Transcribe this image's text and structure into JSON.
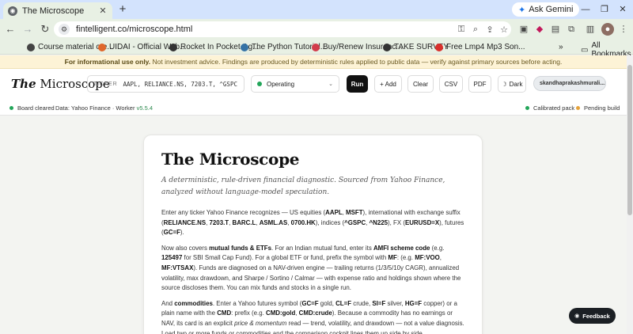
{
  "browser": {
    "tab": {
      "title": "The Microscope",
      "favicon": "globe-icon"
    },
    "gemini_label": "Ask Gemini",
    "url": "fintelligent.co/microscope.html",
    "bookmarks": [
      {
        "label": "Course material cre...",
        "color": "#444"
      },
      {
        "label": "UIDAI - Official Web...",
        "color": "#e0672c"
      },
      {
        "label": "Rocket In Pocket-Ag...",
        "color": "#333"
      },
      {
        "label": "The Python Tutorial...",
        "color": "#3572a5"
      },
      {
        "label": "Buy/Renew Insuranc...",
        "color": "#d23b4b"
      },
      {
        "label": "TAKE SURVEY",
        "color": "#333"
      },
      {
        "label": "Free Lmp4 Mp3 Son...",
        "color": "#d9302c"
      }
    ],
    "all_bookmarks": "All Bookmarks"
  },
  "disclaimer": {
    "bold": "For informational use only.",
    "text": "Not investment advice. Findings are produced by deterministic rules applied to public data — verify against primary sources before acting."
  },
  "appbar": {
    "logo_the": "The",
    "logo_rest": "Microscope",
    "ticker_label": "TICKER",
    "ticker_value": "AAPL, RELIANCE.NS, 7203.T, ^GSPC",
    "mode": "Operating",
    "run": "Run",
    "add": "+ Add",
    "clear": "Clear",
    "csv": "CSV",
    "pdf": "PDF",
    "dark": "Dark",
    "user": "skandhaprakashmurali..."
  },
  "status": {
    "left": "Board cleared",
    "data": "Data: Yahoo Finance · Worker",
    "version": "v5.5.4",
    "calibrated": "Calibrated pack",
    "pending": "Pending build",
    "colors": {
      "ok": "#22a559",
      "pending": "#e5a23a"
    }
  },
  "card": {
    "title": "The Microscope",
    "subtitle": "A deterministic, rule-driven financial diagnostic. Sourced from Yahoo Finance, analyzed without language-model speculation.",
    "p1": [
      {
        "t": "Enter any ticker Yahoo Finance recognizes — US equities ("
      },
      {
        "t": "AAPL",
        "b": true
      },
      {
        "t": ", "
      },
      {
        "t": "MSFT",
        "b": true
      },
      {
        "t": "), international with exchange suffix ("
      },
      {
        "t": "RELIANCE.NS",
        "b": true
      },
      {
        "t": ", "
      },
      {
        "t": "7203.T",
        "b": true
      },
      {
        "t": ", "
      },
      {
        "t": "BARC.L",
        "b": true
      },
      {
        "t": ", "
      },
      {
        "t": "ASML.AS",
        "b": true
      },
      {
        "t": ", "
      },
      {
        "t": "0700.HK",
        "b": true
      },
      {
        "t": "), indices ("
      },
      {
        "t": "^GSPC",
        "b": true
      },
      {
        "t": ", "
      },
      {
        "t": "^N225",
        "b": true
      },
      {
        "t": "), FX ("
      },
      {
        "t": "EURUSD=X",
        "b": true
      },
      {
        "t": "), futures ("
      },
      {
        "t": "GC=F",
        "b": true
      },
      {
        "t": ")."
      }
    ],
    "p2": [
      {
        "t": "Now also covers "
      },
      {
        "t": "mutual funds & ETFs",
        "b": true
      },
      {
        "t": ". For an Indian mutual fund, enter its "
      },
      {
        "t": "AMFI scheme code",
        "b": true
      },
      {
        "t": " (e.g. "
      },
      {
        "t": "125497",
        "b": true
      },
      {
        "t": " for SBI Small Cap Fund). For a global ETF or fund, prefix the symbol with "
      },
      {
        "t": "MF",
        "b": true
      },
      {
        "t": ": (e.g. "
      },
      {
        "t": "MF:VOO",
        "b": true
      },
      {
        "t": ", "
      },
      {
        "t": "MF:VTSAX",
        "b": true
      },
      {
        "t": "). Funds are diagnosed on a NAV-driven engine — trailing returns (1/3/5/10y CAGR), annualized volatility, max drawdown, and Sharpe / Sortino / Calmar — with expense ratio and holdings shown where the source discloses them. You can mix funds and stocks in a single run."
      }
    ],
    "p3": [
      {
        "t": "And "
      },
      {
        "t": "commodities",
        "b": true
      },
      {
        "t": ". Enter a Yahoo futures symbol ("
      },
      {
        "t": "GC=F",
        "b": true
      },
      {
        "t": " gold, "
      },
      {
        "t": "CL=F",
        "b": true
      },
      {
        "t": " crude, "
      },
      {
        "t": "SI=F",
        "b": true
      },
      {
        "t": " silver, "
      },
      {
        "t": "HG=F",
        "b": true
      },
      {
        "t": " copper) or a plain name with the "
      },
      {
        "t": "CMD",
        "b": true
      },
      {
        "t": ": prefix (e.g. "
      },
      {
        "t": "CMD:gold",
        "b": true
      },
      {
        "t": ", "
      },
      {
        "t": "CMD:crude",
        "b": true
      },
      {
        "t": "). Because a commodity has no earnings or NAV, its card is an explicit "
      },
      {
        "t": "price & momentum",
        "i": true
      },
      {
        "t": " read — trend, volatility, and drawdown — not a value diagnosis. Load two or more funds or commodities and the comparison cockpit lines them up side by side."
      }
    ]
  },
  "feedback": "Feedback"
}
